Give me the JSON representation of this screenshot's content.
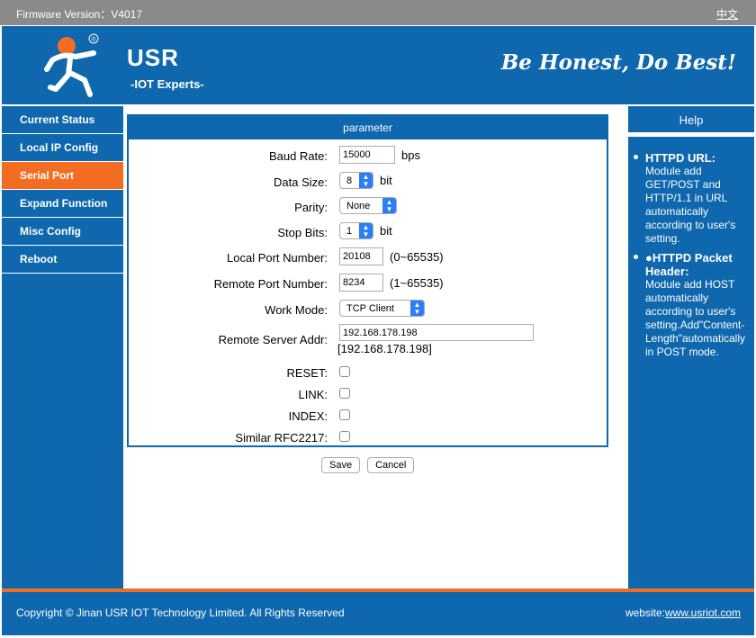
{
  "topbar": {
    "firmware": "Firmware Version：V4017",
    "language": "中文"
  },
  "header": {
    "brand": "USR",
    "sub": "-IOT Experts-",
    "slogan": "Be Honest, Do Best!",
    "logo_mark": "®"
  },
  "sidebar": {
    "items": [
      {
        "label": "Current Status"
      },
      {
        "label": "Local IP Config"
      },
      {
        "label": "Serial Port"
      },
      {
        "label": "Expand Function"
      },
      {
        "label": "Misc Config"
      },
      {
        "label": "Reboot"
      }
    ],
    "active": "Serial Port"
  },
  "form": {
    "title": "parameter",
    "baud_rate": {
      "label": "Baud Rate:",
      "value": "15000",
      "unit": "bps"
    },
    "data_size": {
      "label": "Data Size:",
      "value": "8",
      "unit": "bit"
    },
    "parity": {
      "label": "Parity:",
      "value": "None"
    },
    "stop_bits": {
      "label": "Stop Bits:",
      "value": "1",
      "unit": "bit"
    },
    "local_port": {
      "label": "Local Port Number:",
      "value": "20108",
      "hint": "(0~65535)"
    },
    "remote_port": {
      "label": "Remote Port Number:",
      "value": "8234",
      "hint": "(1~65535)"
    },
    "work_mode": {
      "label": "Work Mode:",
      "value": "TCP Client"
    },
    "remote_addr": {
      "label": "Remote Server Addr:",
      "value": "192.168.178.198",
      "current": "[192.168.178.198]"
    },
    "reset": {
      "label": "RESET:"
    },
    "link": {
      "label": "LINK:"
    },
    "index": {
      "label": "INDEX:"
    },
    "rfc2217": {
      "label": "Similar RFC2217:"
    },
    "save": "Save",
    "cancel": "Cancel"
  },
  "help": {
    "title": "Help",
    "items": [
      {
        "title": "HTTPD URL:",
        "body": "Module add GET/POST and HTTP/1.1 in URL automatically according to user's setting."
      },
      {
        "title": "●HTTPD Packet Header:",
        "body": "Module add HOST automatically according to user's setting.Add\"Content-Length\"automatically in POST mode."
      }
    ]
  },
  "footer": {
    "copyright": "Copyright © Jinan USR IOT Technology Limited. All Rights Reserved",
    "website_label": "website:",
    "website": "www.usriot.com"
  },
  "colors": {
    "primary": "#0f67ae",
    "accent": "#f26d22",
    "topbar": "#8a8a8a"
  }
}
